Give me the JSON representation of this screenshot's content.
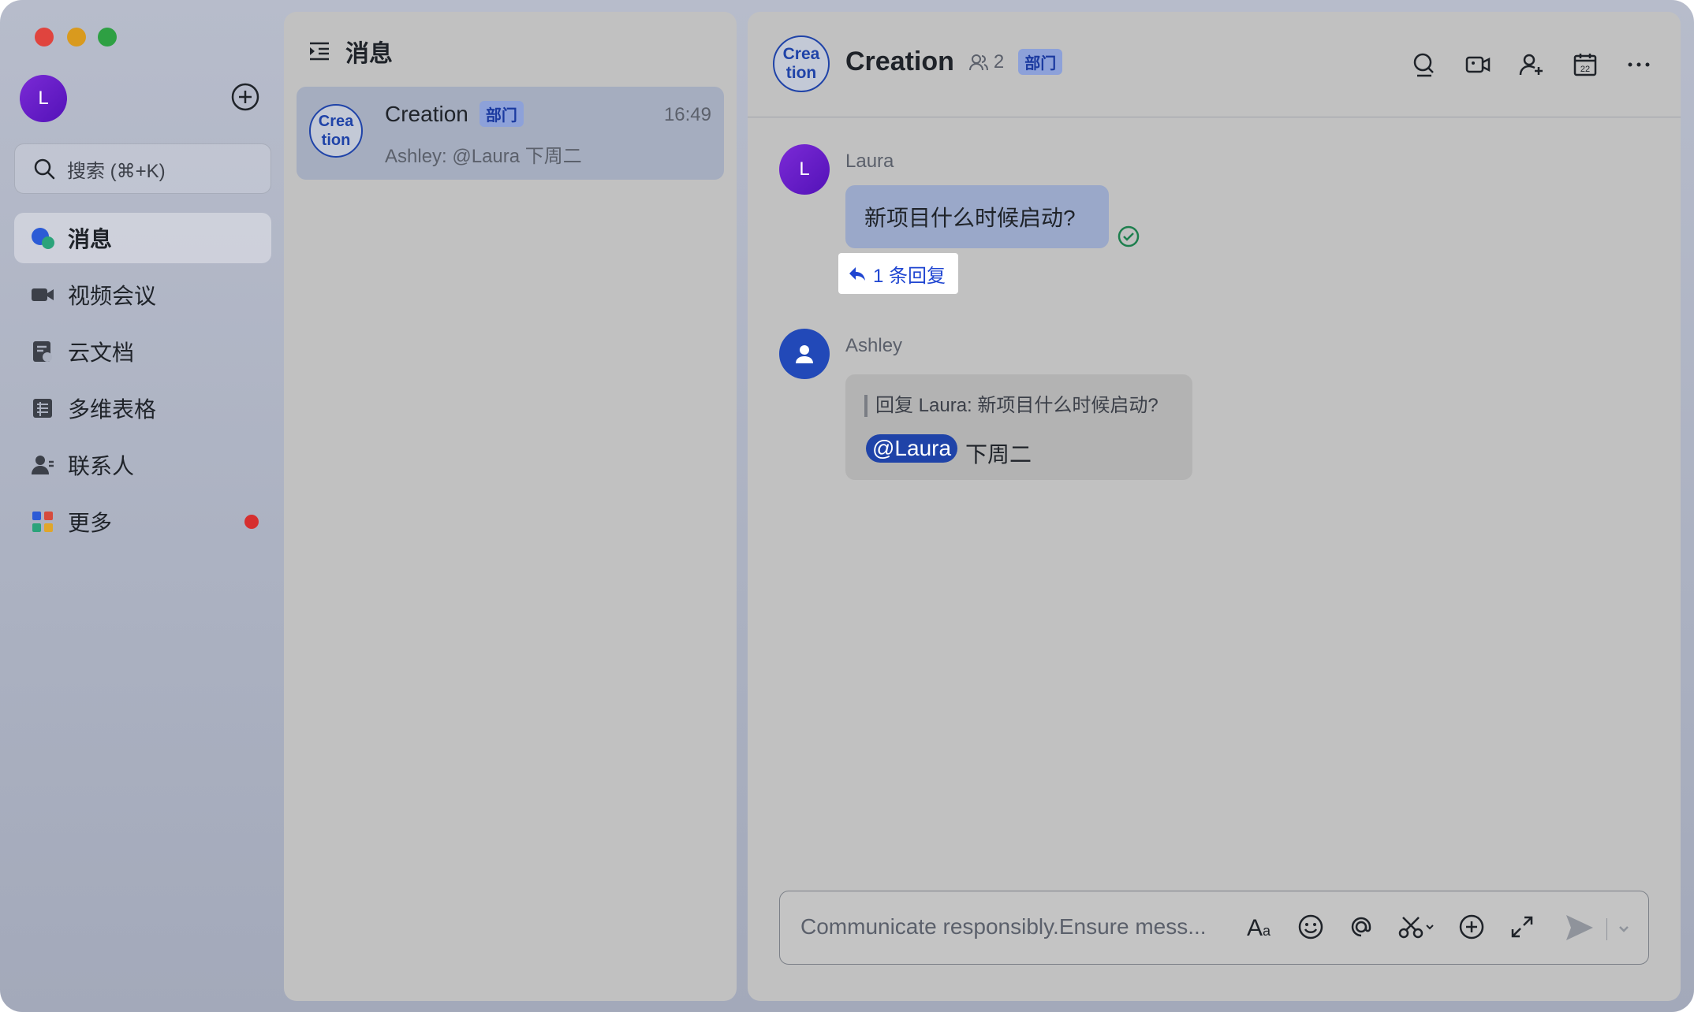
{
  "sidebar": {
    "avatar_letter": "L",
    "search_placeholder": "搜索 (⌘+K)",
    "nav": [
      {
        "label": "消息",
        "icon": "chat-bubbles-icon",
        "active": true
      },
      {
        "label": "视频会议",
        "icon": "video-camera-icon"
      },
      {
        "label": "云文档",
        "icon": "cloud-doc-icon"
      },
      {
        "label": "多维表格",
        "icon": "table-icon"
      },
      {
        "label": "联系人",
        "icon": "contacts-icon"
      },
      {
        "label": "更多",
        "icon": "apps-grid-icon",
        "badge_color": "#d62f2f"
      }
    ]
  },
  "list": {
    "title": "消息",
    "conversation": {
      "avatar_line1": "Crea",
      "avatar_line2": "tion",
      "name": "Creation",
      "tag": "部门",
      "time": "16:49",
      "preview": "Ashley: @Laura 下周二"
    }
  },
  "chat": {
    "avatar_line1": "Crea",
    "avatar_line2": "tion",
    "title": "Creation",
    "member_count": "2",
    "tag": "部门",
    "messages": [
      {
        "sender": "Laura",
        "avatar_letter": "L",
        "text": "新项目什么时候启动?",
        "reply_link": "1 条回复"
      },
      {
        "sender": "Ashley",
        "quote": "回复 Laura:  新项目什么时候启动?",
        "mention": "@Laura",
        "text": "下周二"
      }
    ],
    "input_placeholder": "Communicate responsibly.Ensure mess..."
  },
  "colors": {
    "accent": "#1f43a8",
    "link": "#1f45d1",
    "read": "#1e7f4e",
    "badge": "#d62f2f"
  }
}
